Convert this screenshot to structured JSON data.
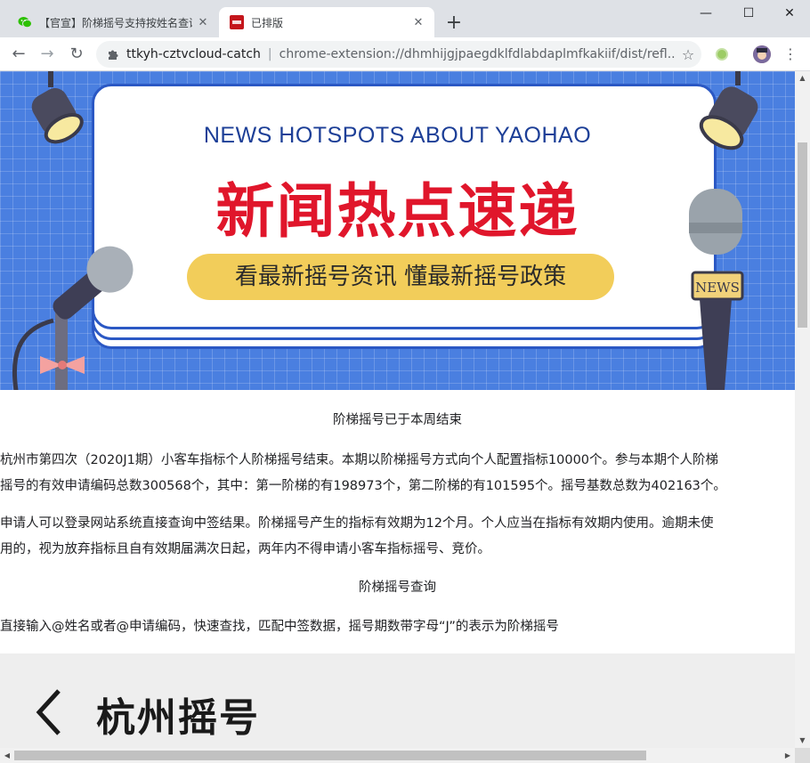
{
  "browser": {
    "tabs": [
      {
        "title": "【官宣】阶梯摇号支持按姓名查询",
        "close": "✕",
        "favicon": "wechat-icon",
        "active": false
      },
      {
        "title": "已排版",
        "close": "✕",
        "favicon": "brand-icon",
        "active": true
      }
    ],
    "new_tab": "+",
    "window_controls": {
      "minimize": "—",
      "maximize": "☐",
      "close": "✕"
    },
    "nav": {
      "back": "←",
      "forward": "→",
      "reload": "↻"
    },
    "omnibox": {
      "site": "ttkyh-cztvcloud-catch",
      "divider": "|",
      "url": "chrome-extension://dhmhijgjpaegdklfdlabdaplmfkakiif/dist/refl...",
      "star": "☆"
    },
    "menu": "⋮"
  },
  "banner": {
    "subtitle": "NEWS HOTSPOTS ABOUT YAOHAO",
    "title": "新闻热点速递",
    "pill": "看最新摇号资讯  懂最新摇号政策",
    "mic_label": "NEWS",
    "colors": {
      "background": "#4a7fe0",
      "title": "#e0162b",
      "subtitle": "#1d3f97",
      "pill": "#f2cd5a",
      "border": "#2b58c4"
    }
  },
  "article": {
    "heading1": "阶梯摇号已于本周结束",
    "para1_line1": "杭州市第四次（2020J1期）小客车指标个人阶梯摇号结束。本期以阶梯摇号方式向个人配置指标10000个。参与本期个人阶梯",
    "para1_line2": "摇号的有效申请编码总数300568个，其中：第一阶梯的有198973个，第二阶梯的有101595个。摇号基数总数为402163个。",
    "para2_line1": "申请人可以登录网站系统直接查询中签结果。阶梯摇号产生的指标有效期为12个月。个人应当在指标有效期内使用。逾期未使",
    "para2_line2": "用的，视为放弃指标且自有效期届满次日起，两年内不得申请小客车指标摇号、竞价。",
    "heading2": "阶梯摇号查询",
    "para3": "直接输入@姓名或者@申请编码，快速查找，匹配中签数据，摇号期数带字母“J”的表示为阶梯摇号"
  },
  "app_screenshot": {
    "title": "杭州摇号"
  },
  "scrollbars": {
    "up": "▲",
    "down": "▼",
    "left": "◀",
    "right": "▶"
  }
}
